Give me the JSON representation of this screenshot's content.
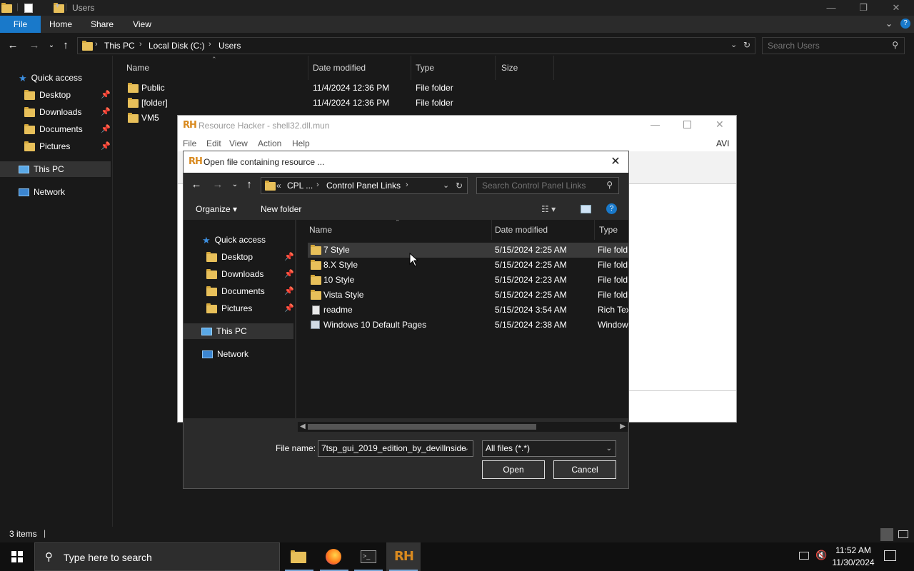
{
  "explorer": {
    "title": "Users",
    "ribbon_tabs": [
      "File",
      "Home",
      "Share",
      "View"
    ],
    "address": [
      "This PC",
      "Local Disk (C:)",
      "Users"
    ],
    "search_placeholder": "Search Users",
    "nav": {
      "quick_access": "Quick access",
      "pinned": [
        "Desktop",
        "Downloads",
        "Documents",
        "Pictures"
      ],
      "this_pc": "This PC",
      "network": "Network"
    },
    "columns": [
      "Name",
      "Date modified",
      "Type",
      "Size"
    ],
    "files": [
      {
        "name": "Public",
        "date": "11/4/2024 12:36 PM",
        "type": "File folder"
      },
      {
        "name": "[folder]",
        "date": "11/4/2024 12:36 PM",
        "type": "File folder"
      },
      {
        "name": "VM5",
        "date": "",
        "type": ""
      }
    ],
    "status": "3 items"
  },
  "resource_hacker": {
    "title": "Resource Hacker - shell32.dll.mun",
    "logo": "RH",
    "menu": [
      "File",
      "Edit",
      "View",
      "Action",
      "Help"
    ],
    "menu_right": "AVI"
  },
  "dialog": {
    "title": "Open file containing resource ...",
    "address": [
      "CPL ...",
      "Control Panel Links"
    ],
    "address_prefix": "«",
    "search_placeholder": "Search Control Panel Links",
    "organize": "Organize ▾",
    "new_folder": "New folder",
    "nav": {
      "quick_access": "Quick access",
      "pinned": [
        "Desktop",
        "Downloads",
        "Documents",
        "Pictures"
      ],
      "this_pc": "This PC",
      "network": "Network"
    },
    "columns": [
      "Name",
      "Date modified",
      "Type"
    ],
    "files": [
      {
        "name": "7 Style",
        "date": "5/15/2024 2:25 AM",
        "type": "File fold",
        "icon": "folder-icon"
      },
      {
        "name": "8.X Style",
        "date": "5/15/2024 2:25 AM",
        "type": "File fold",
        "icon": "folder-icon"
      },
      {
        "name": "10 Style",
        "date": "5/15/2024 2:23 AM",
        "type": "File fold",
        "icon": "folder-icon"
      },
      {
        "name": "Vista Style",
        "date": "5/15/2024 2:25 AM",
        "type": "File fold",
        "icon": "folder-icon"
      },
      {
        "name": "readme",
        "date": "5/15/2024 3:54 AM",
        "type": "Rich Tex",
        "icon": "document-icon"
      },
      {
        "name": "Windows 10 Default Pages",
        "date": "5/15/2024 2:38 AM",
        "type": "Window",
        "icon": "webpage-icon"
      }
    ],
    "filename_label": "File name:",
    "filename_value": "7tsp_gui_2019_edition_by_devillnside",
    "filter_value": "All files (*.*)",
    "open_label": "Open",
    "cancel_label": "Cancel"
  },
  "taskbar": {
    "search_placeholder": "Type here to search",
    "time": "11:52 AM",
    "date": "11/30/2024"
  },
  "colors": {
    "accent": "#1979ca",
    "folder": "#e8c05a",
    "rh_logo": "#d98a1f",
    "power": "#dd2222"
  }
}
